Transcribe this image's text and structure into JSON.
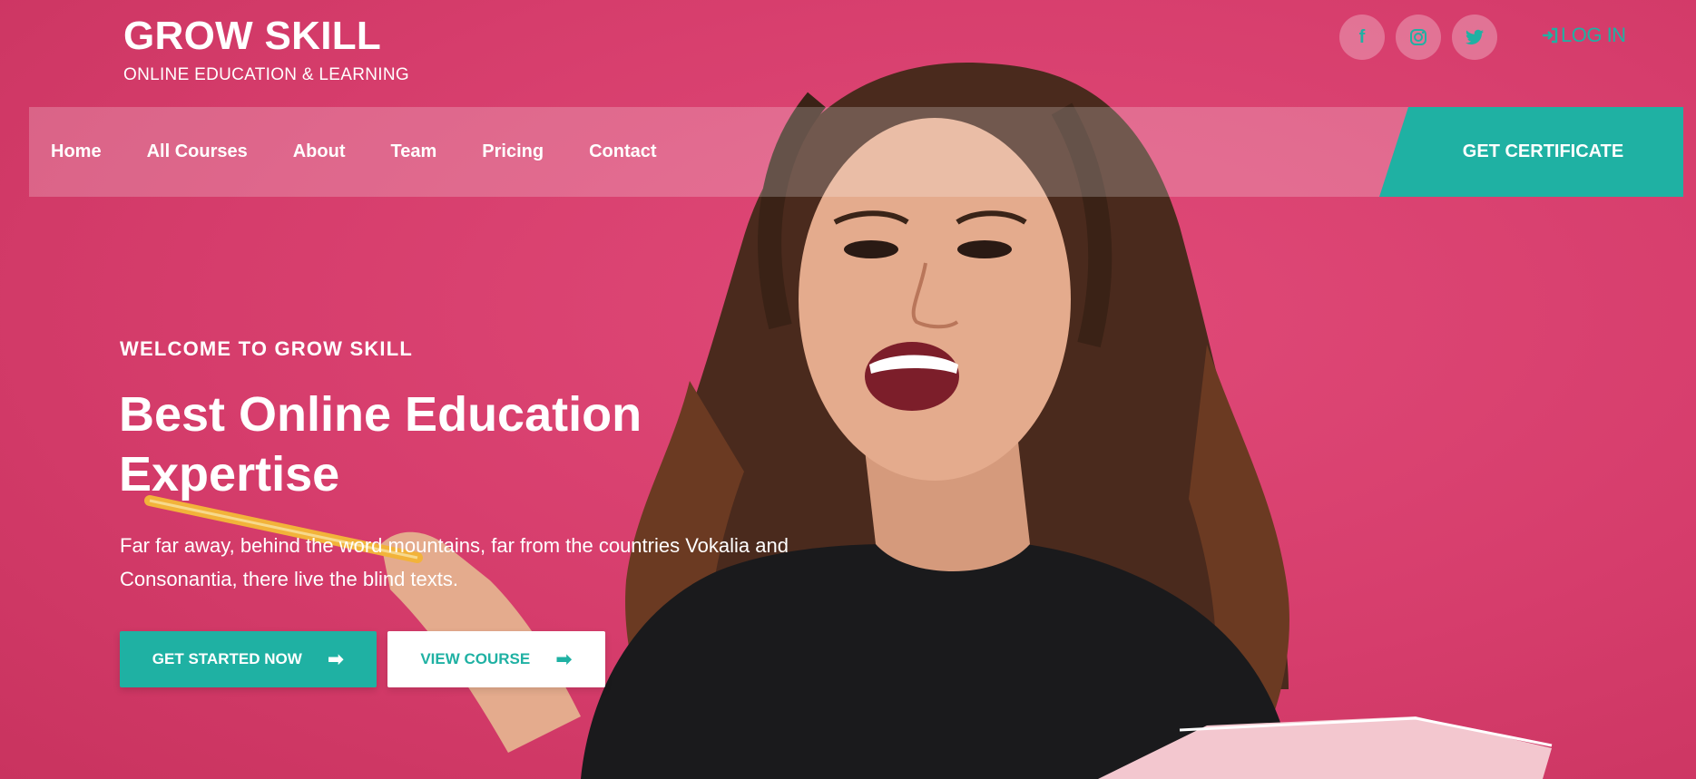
{
  "brand": {
    "title": "GROW SKILL",
    "subtitle": "ONLINE EDUCATION & LEARNING"
  },
  "social": [
    {
      "name": "facebook-icon",
      "glyph": "f"
    },
    {
      "name": "instagram-icon",
      "glyph": ""
    },
    {
      "name": "twitter-icon",
      "glyph": ""
    }
  ],
  "header": {
    "login_label": "LOG IN"
  },
  "nav": {
    "items": [
      "Home",
      "All Courses",
      "About",
      "Team",
      "Pricing",
      "Contact"
    ],
    "cta_label": "GET CERTIFICATE"
  },
  "hero": {
    "eyebrow": "WELCOME TO GROW SKILL",
    "headline_line1": "Best Online Education",
    "headline_line2": "Expertise",
    "description": "Far far away, behind the word mountains, far from the countries Vokalia and Consonantia, there live the blind texts.",
    "primary_button": "GET STARTED NOW",
    "secondary_button": "VIEW COURSE"
  },
  "colors": {
    "background": "#d8406f",
    "accent": "#1fb1a3"
  }
}
